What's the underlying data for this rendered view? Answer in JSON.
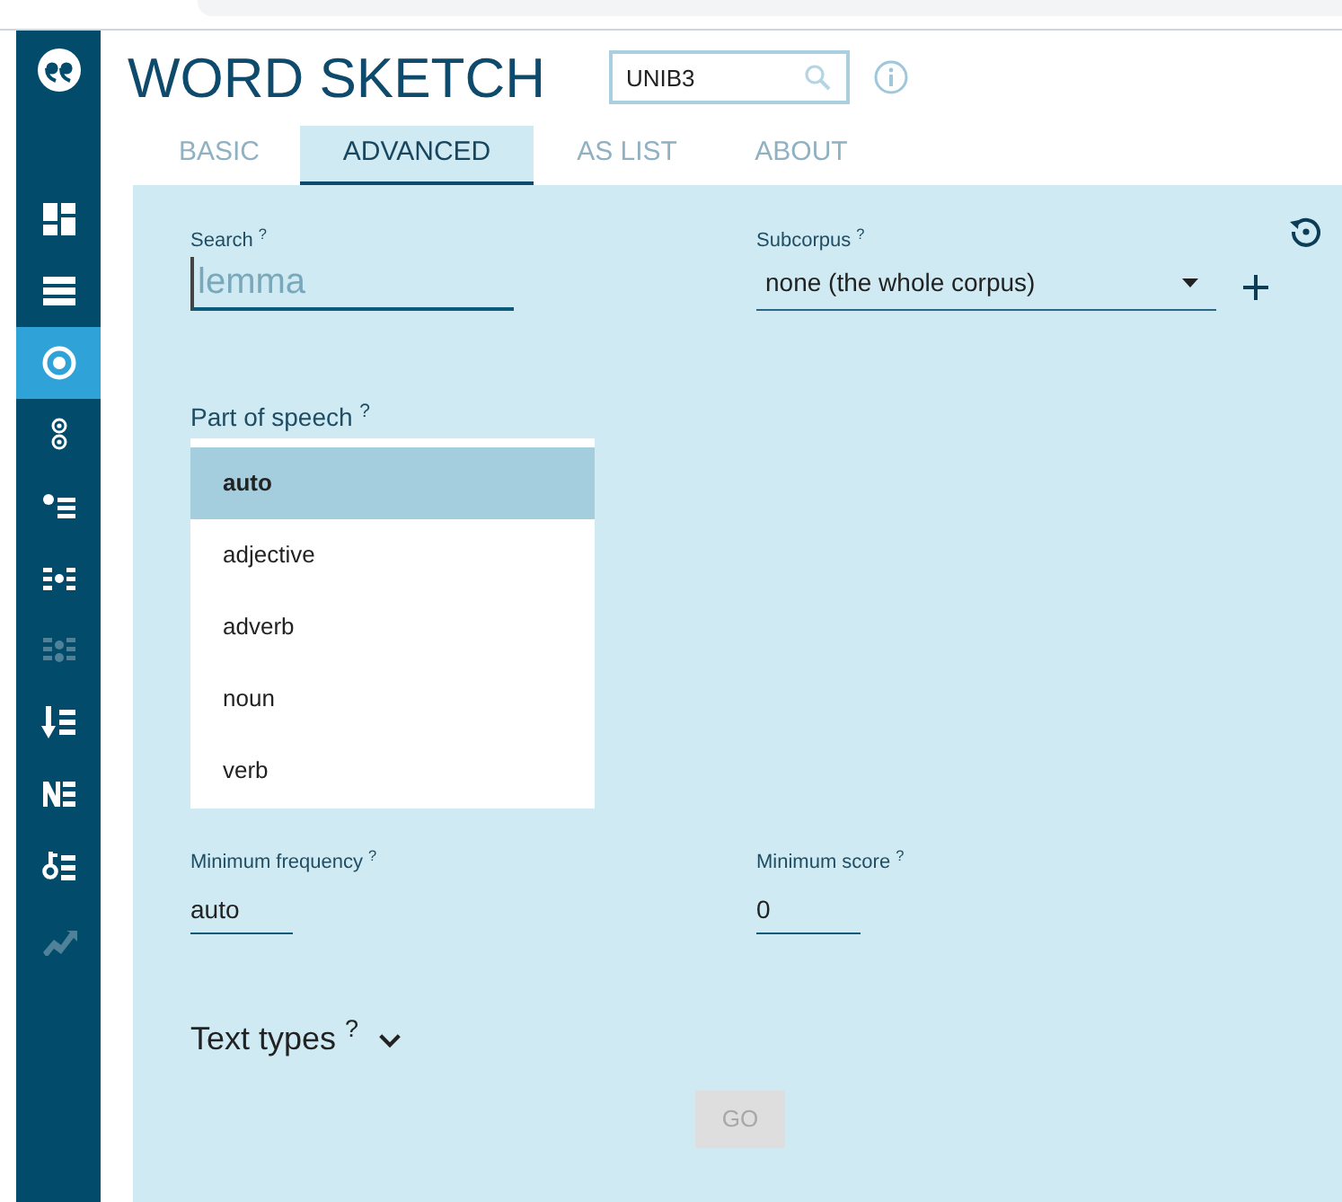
{
  "app": {
    "title": "WORD SKETCH",
    "corpus_field": {
      "value": "UNIB3"
    }
  },
  "sidebar": {
    "items": [
      {
        "kind": "dashboard",
        "selected": false,
        "disabled": false
      },
      {
        "kind": "list",
        "selected": false,
        "disabled": false
      },
      {
        "kind": "target",
        "selected": true,
        "disabled": false
      },
      {
        "kind": "pair",
        "selected": false,
        "disabled": false
      },
      {
        "kind": "dotlist",
        "selected": false,
        "disabled": false
      },
      {
        "kind": "dotgrid",
        "selected": false,
        "disabled": false
      },
      {
        "kind": "dotgrid2",
        "selected": false,
        "disabled": true
      },
      {
        "kind": "sortlist",
        "selected": false,
        "disabled": false
      },
      {
        "kind": "nlist",
        "selected": false,
        "disabled": false
      },
      {
        "kind": "keylist",
        "selected": false,
        "disabled": false
      },
      {
        "kind": "trend",
        "selected": false,
        "disabled": true
      }
    ]
  },
  "tabs": [
    {
      "label": "BASIC",
      "selected": false
    },
    {
      "label": "ADVANCED",
      "selected": true
    },
    {
      "label": "AS LIST",
      "selected": false
    },
    {
      "label": "ABOUT",
      "selected": false
    }
  ],
  "form": {
    "search": {
      "label": "Search $^{?}$",
      "placeholder": "lemma"
    },
    "subcorpus": {
      "label": "Subcorpus $^{?}$",
      "value": "none (the whole corpus)"
    },
    "part_of_speech": {
      "label": "Part of speech $^{?}$",
      "options": [
        {
          "label": "auto",
          "selected": true
        },
        {
          "label": "adjective",
          "selected": false
        },
        {
          "label": "adverb",
          "selected": false
        },
        {
          "label": "noun",
          "selected": false
        },
        {
          "label": "verb",
          "selected": false
        }
      ]
    },
    "minimum_frequency": {
      "label": "Minimum frequency $^{?}$",
      "value": "auto"
    },
    "minimum_score": {
      "label": "Minimum score $^{?}$",
      "value": "0"
    },
    "text_types": {
      "label": "Text types $^{?}$",
      "expanded": false
    },
    "go_button": {
      "label": "GO",
      "disabled": true
    }
  }
}
